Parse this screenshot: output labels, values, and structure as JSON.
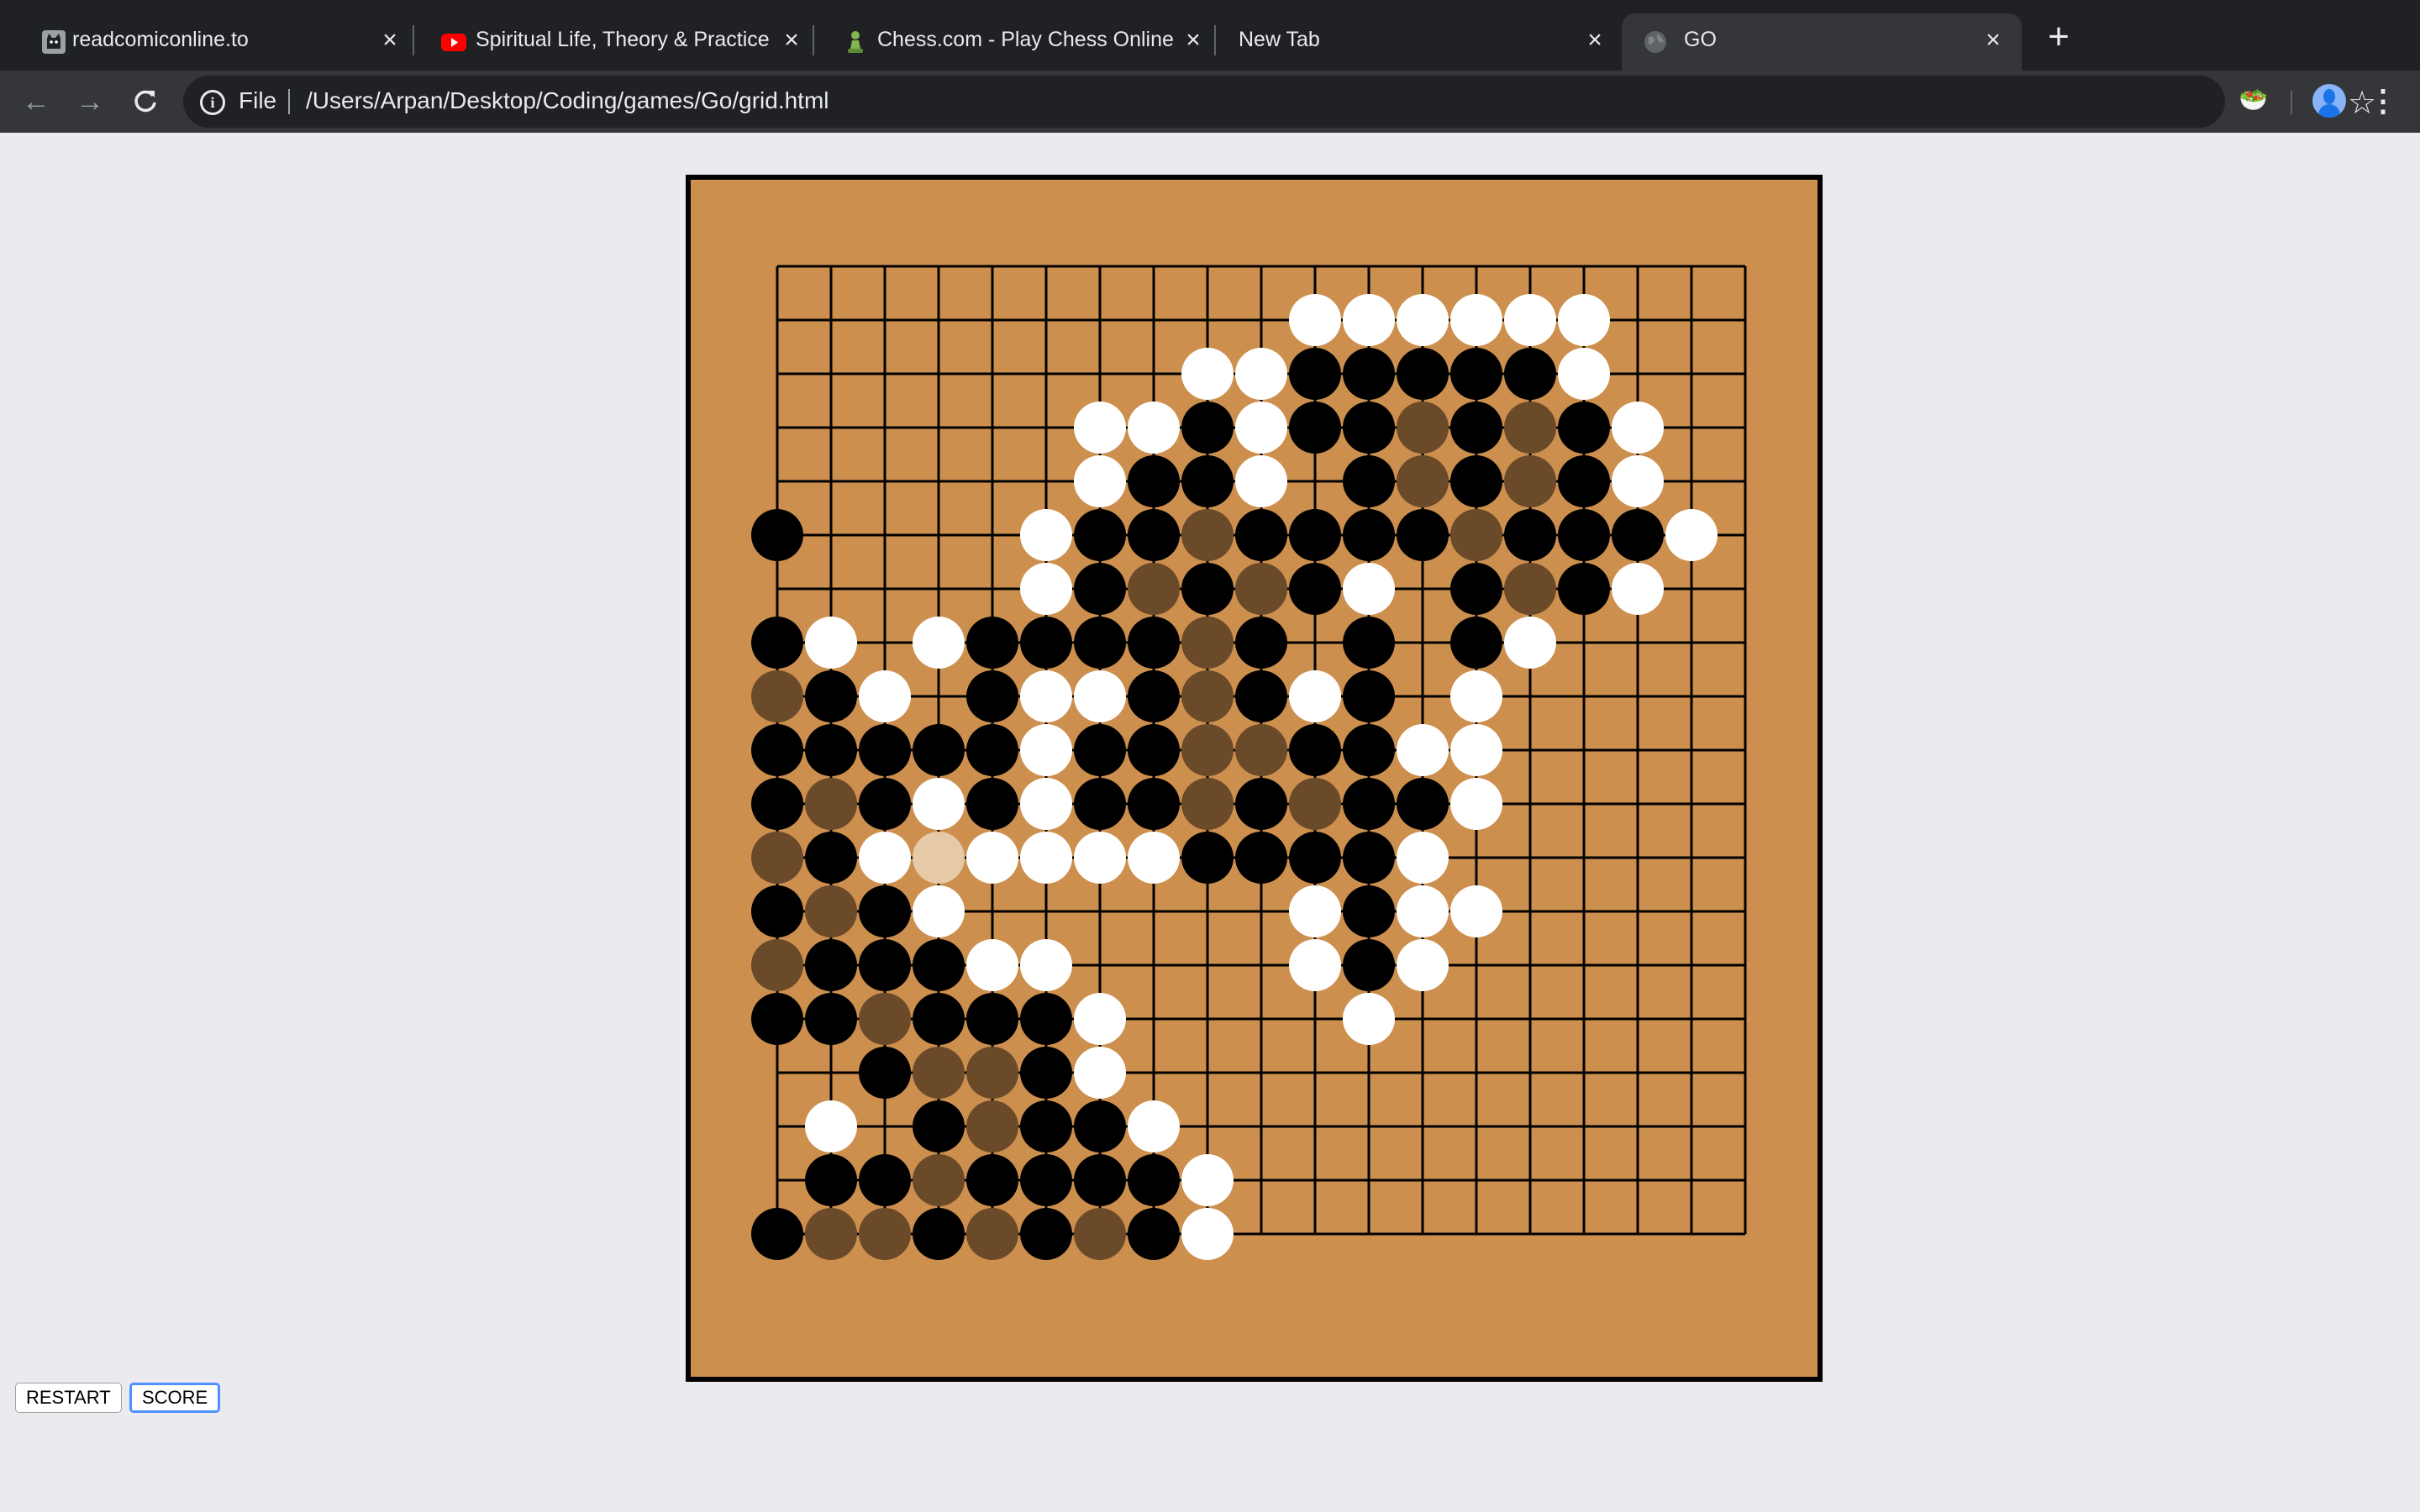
{
  "browser": {
    "tabs": [
      {
        "title": "readcomiconline.to",
        "favicon": "cat-favicon-icon",
        "active": false
      },
      {
        "title": "Spiritual Life, Theory & Practice",
        "favicon": "youtube-icon",
        "active": false
      },
      {
        "title": "Chess.com - Play Chess Online",
        "favicon": "chess-pawn-icon",
        "active": false
      },
      {
        "title": "New Tab",
        "favicon": "",
        "active": false
      },
      {
        "title": "GO",
        "favicon": "globe-icon",
        "active": true
      }
    ],
    "address": {
      "scheme_label": "File",
      "url": "/Users/Arpan/Desktop/Coding/games/Go/grid.html"
    }
  },
  "board": {
    "size": 19,
    "colors": {
      "wood": "#cd8f4e",
      "frame": "#000000",
      "black_stone": "#000000",
      "white_stone": "#ffffff",
      "black_territory_marker": "#6b4a2a",
      "white_territory_marker": "#e6c9a6"
    },
    "legend": "Row strings top to bottom, 19 columns left to right. B=black, W=white, b=black territory marker, w=white territory marker, .=empty",
    "rows": [
      "...................",
      "..........WWWWWW...",
      "........WWBBBBBW...",
      "......WWBWBBbBbBW...",
      "......WBBW.BbBbBW...",
      "B....WBBbBBBBbBBBW.",
      ".....WBbBbBW.BbBW..",
      "BW.WBBBBbB.B.BW....",
      "bBW.BWWBbBWB.W.....",
      "BBBBBWBBbbBBWW.....",
      "BbBWBWBBbBbBBW.....",
      "bBWwWWWWBBBBW......",
      "BbBW......WBWW.....",
      "bBBBWW....WBW......",
      "BBbBBBW....W.......",
      "..BbbBW............",
      ".W.BbBBW...........",
      ".BBbBBBBW..........",
      "BbbBbBbBW.........."
    ]
  },
  "controls": {
    "restart_label": "RESTART",
    "score_label": "SCORE"
  }
}
